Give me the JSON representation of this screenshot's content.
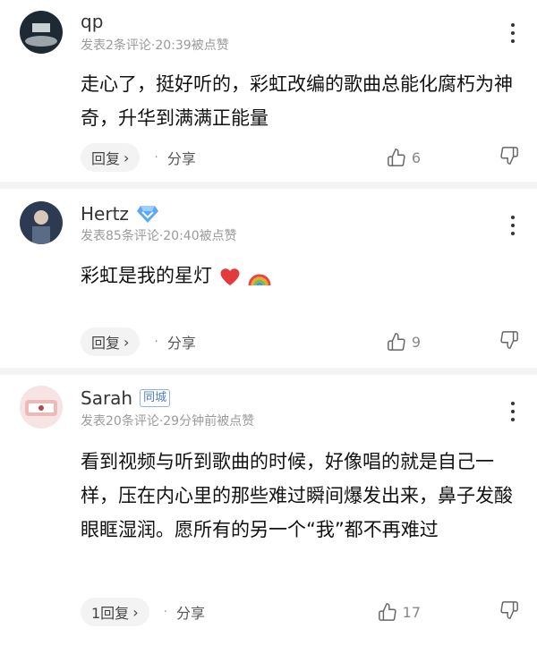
{
  "comments": [
    {
      "username": "qp",
      "meta": "发表2条评论·20:39被点赞",
      "text": "走心了，挺好听的，彩虹改编的歌曲总能化腐朽为神奇，升华到满满正能量",
      "reply_label": "回复",
      "share_label": "分享",
      "like_count": "6"
    },
    {
      "username": "Hertz",
      "meta": "发表85条评论·20:40被点赞",
      "text": "彩虹是我的星灯",
      "reply_label": "回复",
      "share_label": "分享",
      "like_count": "9",
      "badge_icon": "diamond-icon",
      "trailing_emojis": [
        "red-heart-emoji",
        "rainbow-emoji"
      ]
    },
    {
      "username": "Sarah",
      "tag": "同城",
      "meta": "发表20条评论·29分钟前被点赞",
      "text": "看到视频与听到歌曲的时候，好像唱的就是自己一样，压在内心里的那些难过瞬间爆发出来，鼻子发酸眼眶湿润。愿所有的另一个“我”都不再难过",
      "reply_label": "1回复",
      "share_label": "分享",
      "like_count": "17"
    }
  ],
  "colors": {
    "text": "#111111",
    "meta": "#9a9a9a",
    "tag": "#4a7fd1",
    "button_bg": "#f3f3f3"
  }
}
